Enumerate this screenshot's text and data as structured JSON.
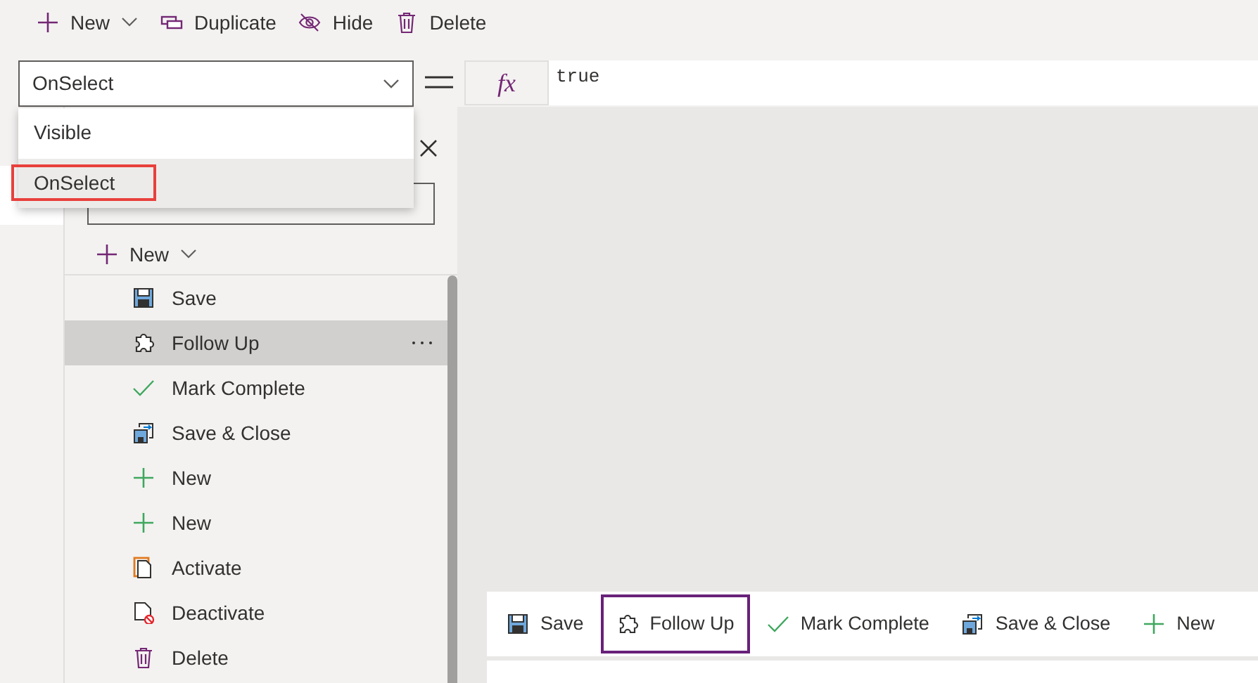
{
  "toolbar": [
    {
      "kind": "new",
      "label": "New",
      "has_caret": true
    },
    {
      "kind": "duplicate",
      "label": "Duplicate",
      "has_caret": false
    },
    {
      "kind": "hide",
      "label": "Hide",
      "has_caret": false
    },
    {
      "kind": "delete",
      "label": "Delete",
      "has_caret": false
    }
  ],
  "property_select": {
    "value": "OnSelect",
    "options": [
      {
        "label": "Visible",
        "selected": false,
        "highlighted": false
      },
      {
        "label": "OnSelect",
        "selected": true,
        "highlighted": true
      }
    ]
  },
  "formula": {
    "fx_label": "fx",
    "value": "true"
  },
  "panel": {
    "new_button": {
      "label": "New"
    },
    "items": [
      {
        "kind": "save",
        "label": "Save",
        "selected": false
      },
      {
        "kind": "follow",
        "label": "Follow Up",
        "selected": true
      },
      {
        "kind": "check",
        "label": "Mark Complete",
        "selected": false
      },
      {
        "kind": "saveclose",
        "label": "Save & Close",
        "selected": false
      },
      {
        "kind": "plus",
        "label": "New",
        "selected": false
      },
      {
        "kind": "plus",
        "label": "New",
        "selected": false
      },
      {
        "kind": "activate",
        "label": "Activate",
        "selected": false
      },
      {
        "kind": "deactivate",
        "label": "Deactivate",
        "selected": false
      },
      {
        "kind": "delete",
        "label": "Delete",
        "selected": false
      }
    ]
  },
  "command_bar": [
    {
      "kind": "save",
      "label": "Save",
      "focused": false
    },
    {
      "kind": "follow",
      "label": "Follow Up",
      "focused": true
    },
    {
      "kind": "check",
      "label": "Mark Complete",
      "focused": false
    },
    {
      "kind": "saveclose",
      "label": "Save & Close",
      "focused": false
    },
    {
      "kind": "plus",
      "label": "New",
      "focused": false
    }
  ]
}
